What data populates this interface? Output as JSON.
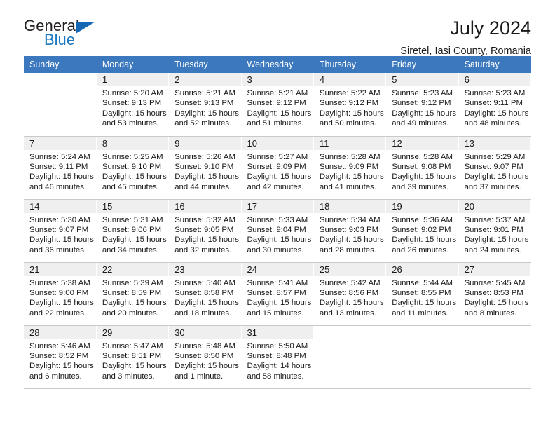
{
  "brand": {
    "name_part1": "General",
    "name_part2": "Blue",
    "triangle_icon": "blue-triangle-icon",
    "accent_color": "#1c79c0"
  },
  "header": {
    "title": "July 2024",
    "subtitle": "Siretel, Iasi County, Romania"
  },
  "theme": {
    "header_bg": "#3b78be",
    "header_text": "#ffffff",
    "daynum_bg": "#efefef",
    "grid_line": "#c9c9c9"
  },
  "weekdays": [
    "Sunday",
    "Monday",
    "Tuesday",
    "Wednesday",
    "Thursday",
    "Friday",
    "Saturday"
  ],
  "weeks": [
    [
      {
        "day": "",
        "blank": true,
        "sunrise": "",
        "sunset": "",
        "daylight1": "",
        "daylight2": ""
      },
      {
        "day": "1",
        "sunrise": "Sunrise: 5:20 AM",
        "sunset": "Sunset: 9:13 PM",
        "daylight1": "Daylight: 15 hours",
        "daylight2": "and 53 minutes."
      },
      {
        "day": "2",
        "sunrise": "Sunrise: 5:21 AM",
        "sunset": "Sunset: 9:13 PM",
        "daylight1": "Daylight: 15 hours",
        "daylight2": "and 52 minutes."
      },
      {
        "day": "3",
        "sunrise": "Sunrise: 5:21 AM",
        "sunset": "Sunset: 9:12 PM",
        "daylight1": "Daylight: 15 hours",
        "daylight2": "and 51 minutes."
      },
      {
        "day": "4",
        "sunrise": "Sunrise: 5:22 AM",
        "sunset": "Sunset: 9:12 PM",
        "daylight1": "Daylight: 15 hours",
        "daylight2": "and 50 minutes."
      },
      {
        "day": "5",
        "sunrise": "Sunrise: 5:23 AM",
        "sunset": "Sunset: 9:12 PM",
        "daylight1": "Daylight: 15 hours",
        "daylight2": "and 49 minutes."
      },
      {
        "day": "6",
        "sunrise": "Sunrise: 5:23 AM",
        "sunset": "Sunset: 9:11 PM",
        "daylight1": "Daylight: 15 hours",
        "daylight2": "and 48 minutes."
      }
    ],
    [
      {
        "day": "7",
        "sunrise": "Sunrise: 5:24 AM",
        "sunset": "Sunset: 9:11 PM",
        "daylight1": "Daylight: 15 hours",
        "daylight2": "and 46 minutes."
      },
      {
        "day": "8",
        "sunrise": "Sunrise: 5:25 AM",
        "sunset": "Sunset: 9:10 PM",
        "daylight1": "Daylight: 15 hours",
        "daylight2": "and 45 minutes."
      },
      {
        "day": "9",
        "sunrise": "Sunrise: 5:26 AM",
        "sunset": "Sunset: 9:10 PM",
        "daylight1": "Daylight: 15 hours",
        "daylight2": "and 44 minutes."
      },
      {
        "day": "10",
        "sunrise": "Sunrise: 5:27 AM",
        "sunset": "Sunset: 9:09 PM",
        "daylight1": "Daylight: 15 hours",
        "daylight2": "and 42 minutes."
      },
      {
        "day": "11",
        "sunrise": "Sunrise: 5:28 AM",
        "sunset": "Sunset: 9:09 PM",
        "daylight1": "Daylight: 15 hours",
        "daylight2": "and 41 minutes."
      },
      {
        "day": "12",
        "sunrise": "Sunrise: 5:28 AM",
        "sunset": "Sunset: 9:08 PM",
        "daylight1": "Daylight: 15 hours",
        "daylight2": "and 39 minutes."
      },
      {
        "day": "13",
        "sunrise": "Sunrise: 5:29 AM",
        "sunset": "Sunset: 9:07 PM",
        "daylight1": "Daylight: 15 hours",
        "daylight2": "and 37 minutes."
      }
    ],
    [
      {
        "day": "14",
        "sunrise": "Sunrise: 5:30 AM",
        "sunset": "Sunset: 9:07 PM",
        "daylight1": "Daylight: 15 hours",
        "daylight2": "and 36 minutes."
      },
      {
        "day": "15",
        "sunrise": "Sunrise: 5:31 AM",
        "sunset": "Sunset: 9:06 PM",
        "daylight1": "Daylight: 15 hours",
        "daylight2": "and 34 minutes."
      },
      {
        "day": "16",
        "sunrise": "Sunrise: 5:32 AM",
        "sunset": "Sunset: 9:05 PM",
        "daylight1": "Daylight: 15 hours",
        "daylight2": "and 32 minutes."
      },
      {
        "day": "17",
        "sunrise": "Sunrise: 5:33 AM",
        "sunset": "Sunset: 9:04 PM",
        "daylight1": "Daylight: 15 hours",
        "daylight2": "and 30 minutes."
      },
      {
        "day": "18",
        "sunrise": "Sunrise: 5:34 AM",
        "sunset": "Sunset: 9:03 PM",
        "daylight1": "Daylight: 15 hours",
        "daylight2": "and 28 minutes."
      },
      {
        "day": "19",
        "sunrise": "Sunrise: 5:36 AM",
        "sunset": "Sunset: 9:02 PM",
        "daylight1": "Daylight: 15 hours",
        "daylight2": "and 26 minutes."
      },
      {
        "day": "20",
        "sunrise": "Sunrise: 5:37 AM",
        "sunset": "Sunset: 9:01 PM",
        "daylight1": "Daylight: 15 hours",
        "daylight2": "and 24 minutes."
      }
    ],
    [
      {
        "day": "21",
        "sunrise": "Sunrise: 5:38 AM",
        "sunset": "Sunset: 9:00 PM",
        "daylight1": "Daylight: 15 hours",
        "daylight2": "and 22 minutes."
      },
      {
        "day": "22",
        "sunrise": "Sunrise: 5:39 AM",
        "sunset": "Sunset: 8:59 PM",
        "daylight1": "Daylight: 15 hours",
        "daylight2": "and 20 minutes."
      },
      {
        "day": "23",
        "sunrise": "Sunrise: 5:40 AM",
        "sunset": "Sunset: 8:58 PM",
        "daylight1": "Daylight: 15 hours",
        "daylight2": "and 18 minutes."
      },
      {
        "day": "24",
        "sunrise": "Sunrise: 5:41 AM",
        "sunset": "Sunset: 8:57 PM",
        "daylight1": "Daylight: 15 hours",
        "daylight2": "and 15 minutes."
      },
      {
        "day": "25",
        "sunrise": "Sunrise: 5:42 AM",
        "sunset": "Sunset: 8:56 PM",
        "daylight1": "Daylight: 15 hours",
        "daylight2": "and 13 minutes."
      },
      {
        "day": "26",
        "sunrise": "Sunrise: 5:44 AM",
        "sunset": "Sunset: 8:55 PM",
        "daylight1": "Daylight: 15 hours",
        "daylight2": "and 11 minutes."
      },
      {
        "day": "27",
        "sunrise": "Sunrise: 5:45 AM",
        "sunset": "Sunset: 8:53 PM",
        "daylight1": "Daylight: 15 hours",
        "daylight2": "and 8 minutes."
      }
    ],
    [
      {
        "day": "28",
        "sunrise": "Sunrise: 5:46 AM",
        "sunset": "Sunset: 8:52 PM",
        "daylight1": "Daylight: 15 hours",
        "daylight2": "and 6 minutes."
      },
      {
        "day": "29",
        "sunrise": "Sunrise: 5:47 AM",
        "sunset": "Sunset: 8:51 PM",
        "daylight1": "Daylight: 15 hours",
        "daylight2": "and 3 minutes."
      },
      {
        "day": "30",
        "sunrise": "Sunrise: 5:48 AM",
        "sunset": "Sunset: 8:50 PM",
        "daylight1": "Daylight: 15 hours",
        "daylight2": "and 1 minute."
      },
      {
        "day": "31",
        "sunrise": "Sunrise: 5:50 AM",
        "sunset": "Sunset: 8:48 PM",
        "daylight1": "Daylight: 14 hours",
        "daylight2": "and 58 minutes."
      },
      {
        "day": "",
        "blank": true,
        "sunrise": "",
        "sunset": "",
        "daylight1": "",
        "daylight2": ""
      },
      {
        "day": "",
        "blank": true,
        "sunrise": "",
        "sunset": "",
        "daylight1": "",
        "daylight2": ""
      },
      {
        "day": "",
        "blank": true,
        "sunrise": "",
        "sunset": "",
        "daylight1": "",
        "daylight2": ""
      }
    ]
  ]
}
